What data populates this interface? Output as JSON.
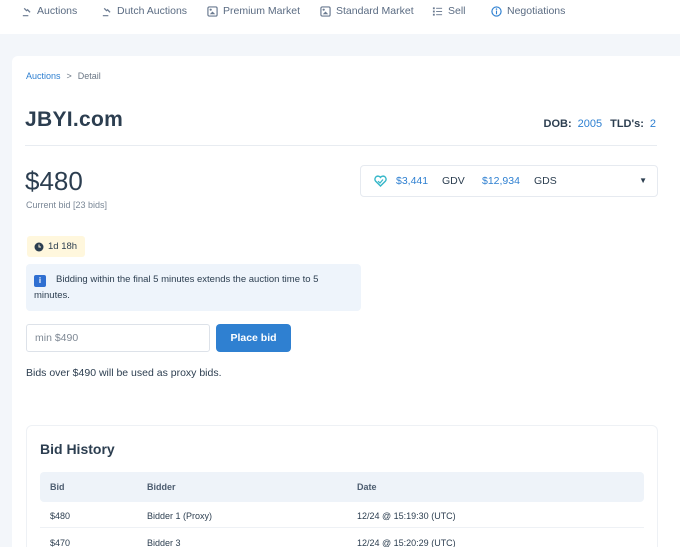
{
  "nav": {
    "items": [
      {
        "label": "Auctions",
        "icon": "gavel-icon"
      },
      {
        "label": "Dutch Auctions",
        "icon": "gavel-icon"
      },
      {
        "label": "Premium Market",
        "icon": "tag-icon"
      },
      {
        "label": "Standard Market",
        "icon": "tag-icon"
      },
      {
        "label": "Sell",
        "icon": "list-icon"
      },
      {
        "label": "Negotiations",
        "icon": "info-circle-icon"
      }
    ]
  },
  "breadcrumb": {
    "parent": "Auctions",
    "separator": ">",
    "current": "Detail"
  },
  "domain": {
    "name": "JBYI.com",
    "dob_label": "DOB:",
    "dob_value": "2005",
    "tlds_label": "TLD's:",
    "tlds_value": "2"
  },
  "bid": {
    "current_price": "$480",
    "current_sub": "Current bid [23 bids]",
    "timer": "1d 18h",
    "notice_icon": "i",
    "notice": "Bidding within the final 5 minutes extends the auction time to 5 minutes.",
    "input_placeholder": "min $490",
    "button_label": "Place bid",
    "proxy_note": "Bids over $490 will be used as proxy bids."
  },
  "stats": {
    "gdv_value": "$3,441",
    "gdv_label": "GDV",
    "gds_value": "$12,934",
    "gds_label": "GDS",
    "caret": "▼"
  },
  "history": {
    "title": "Bid History",
    "columns": [
      "Bid",
      "Bidder",
      "Date"
    ],
    "rows": [
      {
        "bid": "$480",
        "bidder": "Bidder 1 (Proxy)",
        "date": "12/24 @ 15:19:30 (UTC)"
      },
      {
        "bid": "$470",
        "bidder": "Bidder 3",
        "date": "12/24 @ 15:20:29 (UTC)"
      }
    ]
  },
  "colors": {
    "accent": "#2f80d1",
    "timer_bg": "#fff7dd",
    "notice_bg": "#eef4fb"
  }
}
